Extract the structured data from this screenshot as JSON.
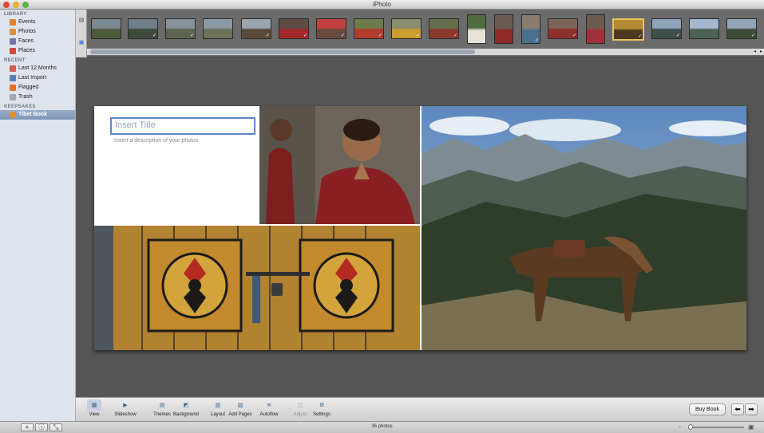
{
  "window": {
    "title": "iPhoto"
  },
  "sidebar": {
    "sections": [
      {
        "heading": "LIBRARY",
        "items": [
          {
            "label": "Events",
            "icon": "events-icon",
            "color": "#e0812e"
          },
          {
            "label": "Photos",
            "icon": "photos-icon",
            "color": "#d8923b"
          },
          {
            "label": "Faces",
            "icon": "faces-icon",
            "color": "#6c79a8"
          },
          {
            "label": "Places",
            "icon": "places-icon",
            "color": "#d24a3b"
          }
        ]
      },
      {
        "heading": "RECENT",
        "items": [
          {
            "label": "Last 12 Months",
            "icon": "calendar-icon",
            "color": "#d55a4f"
          },
          {
            "label": "Last Import",
            "icon": "import-icon",
            "color": "#557fb8"
          },
          {
            "label": "Flagged",
            "icon": "flag-icon",
            "color": "#e56d22"
          },
          {
            "label": "Trash",
            "icon": "trash-icon",
            "color": "#a4a9b0"
          }
        ]
      },
      {
        "heading": "KEEPSAKES",
        "items": [
          {
            "label": "Tibet Book",
            "icon": "book-icon",
            "color": "#e08f3a",
            "selected": true
          }
        ]
      }
    ]
  },
  "filmstrip": {
    "thumbnails": [
      {
        "name": "landscape-valley",
        "checked": false,
        "colors": [
          "#7c8a94",
          "#4c5a3a"
        ]
      },
      {
        "name": "landscape-river",
        "checked": true,
        "colors": [
          "#6f7e88",
          "#3e4b3b"
        ]
      },
      {
        "name": "landscape-plain",
        "checked": true,
        "colors": [
          "#889099",
          "#5d6451"
        ]
      },
      {
        "name": "landscape-steppe",
        "checked": false,
        "colors": [
          "#8c9aa6",
          "#6b7258"
        ]
      },
      {
        "name": "horse-race",
        "checked": true,
        "colors": [
          "#9aa5ad",
          "#5b4b3b"
        ]
      },
      {
        "name": "riders-red",
        "checked": true,
        "colors": [
          "#5d4d45",
          "#a3282b"
        ]
      },
      {
        "name": "crowd-red",
        "checked": true,
        "colors": [
          "#c0413e",
          "#6a4b3f"
        ]
      },
      {
        "name": "rider-red-horse",
        "checked": true,
        "colors": [
          "#6e7b4b",
          "#b33a2f"
        ]
      },
      {
        "name": "rider-yellow",
        "checked": true,
        "colors": [
          "#8a8d6f",
          "#c99d2f"
        ]
      },
      {
        "name": "rider-field",
        "checked": true,
        "colors": [
          "#656e4a",
          "#8a3a2d"
        ]
      },
      {
        "name": "portrait-white",
        "checked": false,
        "colors": [
          "#4f6b3f",
          "#e8e3d8"
        ]
      },
      {
        "name": "monk-standing",
        "checked": false,
        "colors": [
          "#6a5c55",
          "#8e2a28"
        ]
      },
      {
        "name": "monk-blue",
        "checked": true,
        "colors": [
          "#8a7c70",
          "#4b6f8f"
        ]
      },
      {
        "name": "monks-pair",
        "checked": true,
        "colors": [
          "#7a6558",
          "#8d2f2b"
        ]
      },
      {
        "name": "monk-praying",
        "checked": false,
        "colors": [
          "#6d5a4f",
          "#a12f3a"
        ]
      },
      {
        "name": "painted-door",
        "checked": true,
        "selected": true,
        "colors": [
          "#b68a35",
          "#4b3922"
        ]
      },
      {
        "name": "mountains-1",
        "checked": true,
        "colors": [
          "#8ea4bc",
          "#3f4f4a"
        ]
      },
      {
        "name": "mountains-2",
        "checked": false,
        "colors": [
          "#a5b8cf",
          "#4e6257"
        ]
      },
      {
        "name": "horse-mountain",
        "checked": true,
        "colors": [
          "#92a5b7",
          "#3f4a34"
        ]
      }
    ]
  },
  "book": {
    "title_placeholder": "Insert Title",
    "description_placeholder": "Insert a description of your photos"
  },
  "toolbar": {
    "buttons": [
      {
        "label": "View",
        "icon": "view-icon"
      },
      {
        "label": "Slideshow",
        "icon": "play-icon"
      },
      {
        "label": "Themes",
        "icon": "themes-icon"
      },
      {
        "label": "Background",
        "icon": "background-icon"
      },
      {
        "label": "Layout",
        "icon": "layout-icon"
      },
      {
        "label": "Add Pages",
        "icon": "add-pages-icon"
      },
      {
        "label": "Autoflow",
        "icon": "autoflow-icon"
      },
      {
        "label": "Adjust",
        "icon": "adjust-icon",
        "disabled": true
      },
      {
        "label": "Settings",
        "icon": "gear-icon"
      }
    ],
    "buy_book_label": "Buy Book",
    "prev_label": "⬅",
    "next_label": "➡"
  },
  "status": {
    "photo_count": "36 photos",
    "add_label": "+",
    "info_label": "ⓘ",
    "fullscreen_label": "⤡"
  },
  "colors": {
    "accent": "#5d87c5",
    "selection": "#e7c35a"
  }
}
